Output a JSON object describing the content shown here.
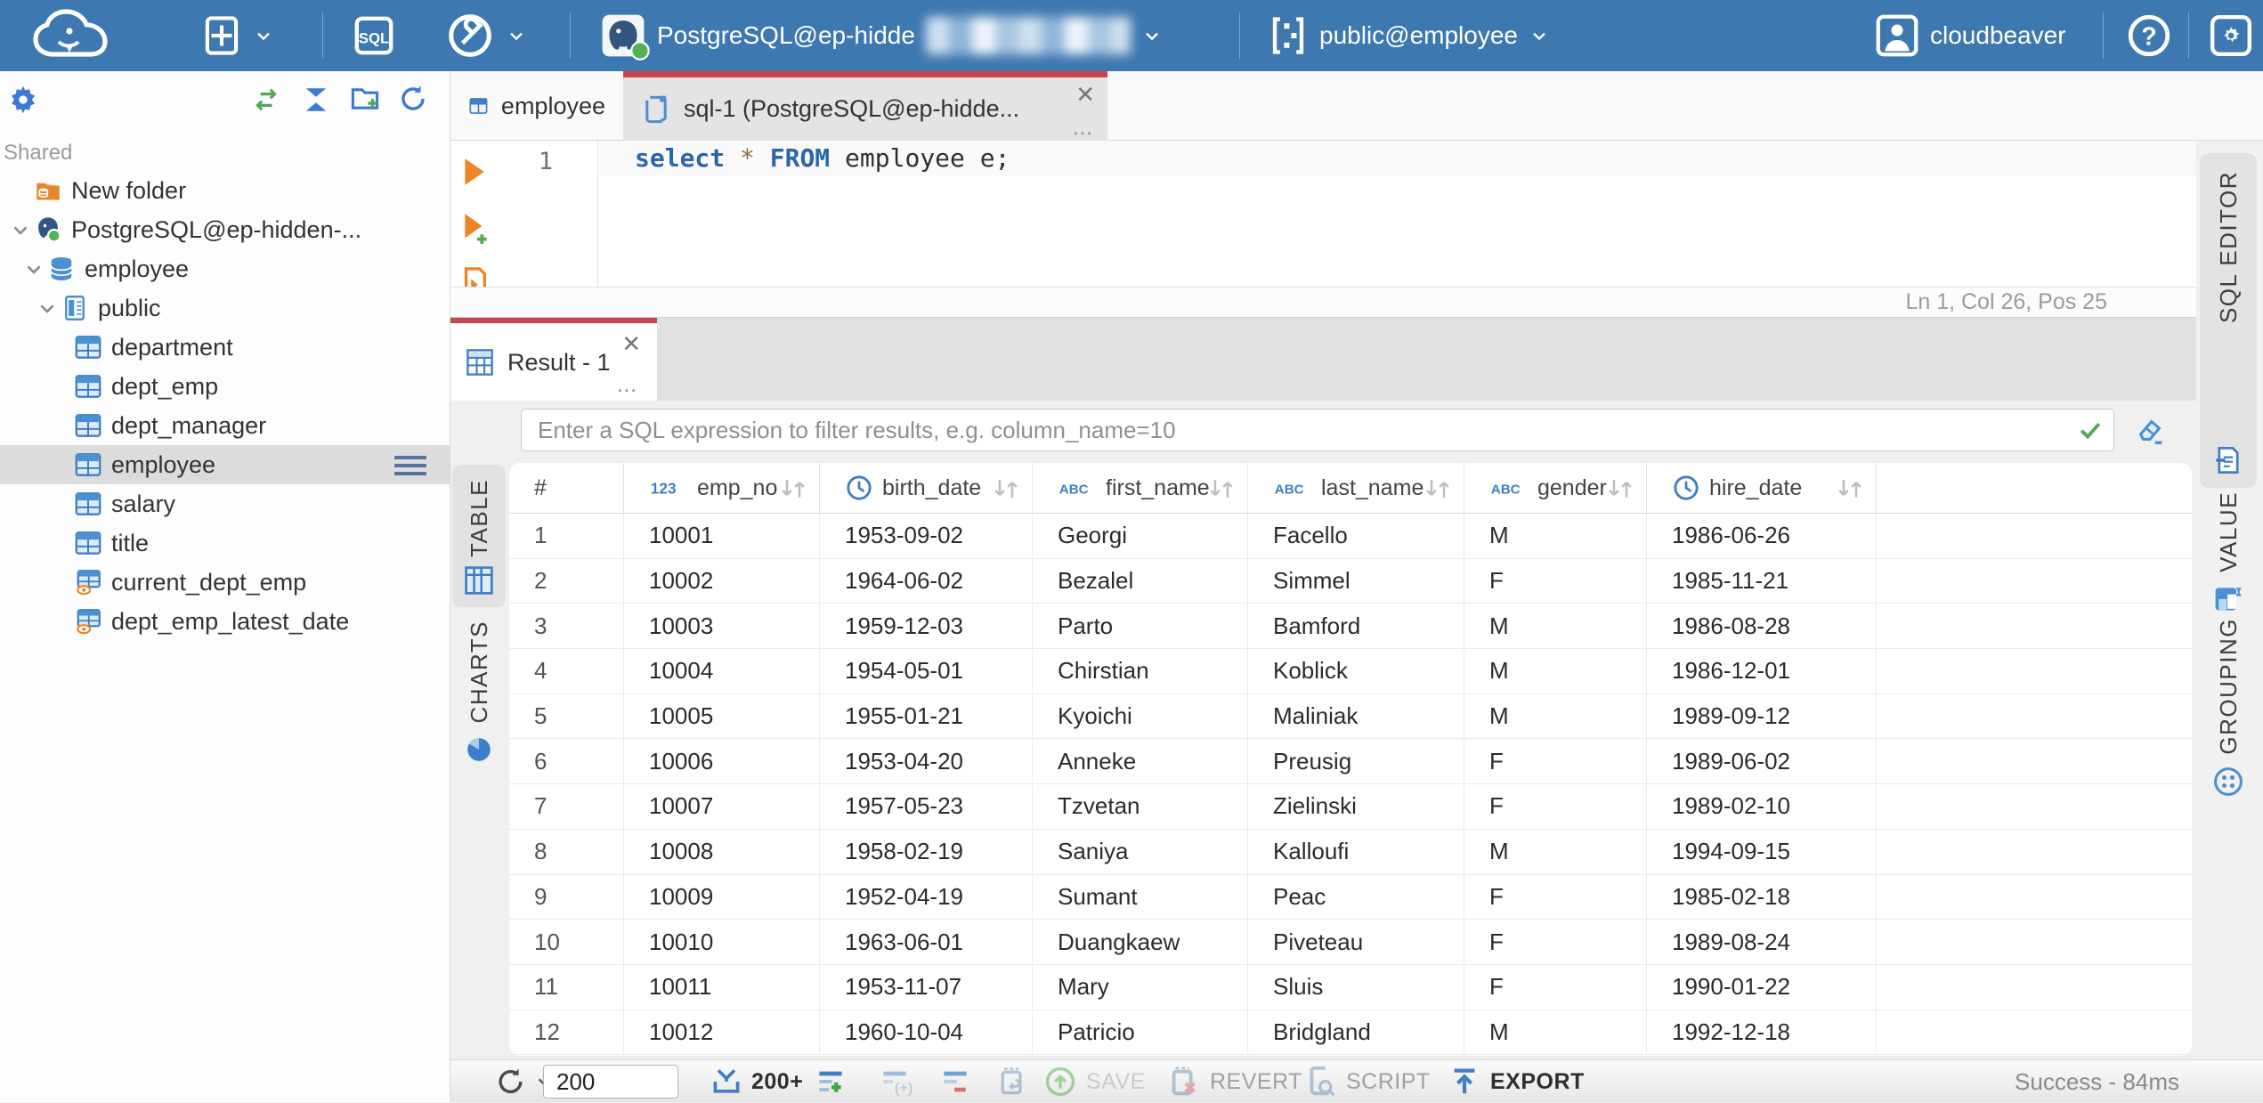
{
  "topbar": {
    "connection": {
      "label": "PostgreSQL@ep-hidde",
      "masked": true
    },
    "schema_selector": "public@employee",
    "user": "cloudbeaver"
  },
  "sidebar": {
    "section_label": "Shared",
    "tree": [
      {
        "label": "New folder",
        "icon": "folder-db",
        "depth": 0,
        "chevron": false
      },
      {
        "label": "PostgreSQL@ep-hidden-...",
        "icon": "postgres",
        "depth": 0,
        "chevron": true
      },
      {
        "label": "employee",
        "icon": "database",
        "depth": 1,
        "chevron": true
      },
      {
        "label": "public",
        "icon": "schema",
        "depth": 2,
        "chevron": true
      },
      {
        "label": "department",
        "icon": "table",
        "depth": 3,
        "chevron": false
      },
      {
        "label": "dept_emp",
        "icon": "table",
        "depth": 3,
        "chevron": false
      },
      {
        "label": "dept_manager",
        "icon": "table",
        "depth": 3,
        "chevron": false
      },
      {
        "label": "employee",
        "icon": "table",
        "depth": 3,
        "chevron": false,
        "selected": true
      },
      {
        "label": "salary",
        "icon": "table",
        "depth": 3,
        "chevron": false
      },
      {
        "label": "title",
        "icon": "table",
        "depth": 3,
        "chevron": false
      },
      {
        "label": "current_dept_emp",
        "icon": "view",
        "depth": 3,
        "chevron": false
      },
      {
        "label": "dept_emp_latest_date",
        "icon": "view",
        "depth": 3,
        "chevron": false
      }
    ]
  },
  "editor": {
    "tabs": [
      {
        "label": "employee",
        "icon": "table",
        "active": false
      },
      {
        "label": "sql-1 (PostgreSQL@ep-hidde...",
        "icon": "sql-script",
        "active": true
      }
    ],
    "line_number": "1",
    "code_tokens": [
      {
        "t": "select",
        "c": "kw"
      },
      {
        "t": " ",
        "c": "pl"
      },
      {
        "t": "*",
        "c": "star"
      },
      {
        "t": " ",
        "c": "pl"
      },
      {
        "t": "FROM",
        "c": "kw"
      },
      {
        "t": " employee e;",
        "c": "pl"
      }
    ],
    "status": "Ln 1, Col 26, Pos 25",
    "rail_tab": "SQL EDITOR"
  },
  "results": {
    "tab_label": "Result - 1",
    "filter_placeholder": "Enter a SQL expression to filter results, e.g. column_name=10",
    "left_rail": [
      {
        "label": "TABLE",
        "active": true
      },
      {
        "label": "CHARTS",
        "active": false
      }
    ],
    "right_rail": [
      {
        "label": "VALUE"
      },
      {
        "label": "GROUPING"
      }
    ],
    "grid": {
      "columns": [
        {
          "name": "#",
          "type": "none"
        },
        {
          "name": "emp_no",
          "type": "number"
        },
        {
          "name": "birth_date",
          "type": "date"
        },
        {
          "name": "first_name",
          "type": "text"
        },
        {
          "name": "last_name",
          "type": "text"
        },
        {
          "name": "gender",
          "type": "text"
        },
        {
          "name": "hire_date",
          "type": "date"
        }
      ],
      "rows": [
        [
          "1",
          "10001",
          "1953-09-02",
          "Georgi",
          "Facello",
          "M",
          "1986-06-26"
        ],
        [
          "2",
          "10002",
          "1964-06-02",
          "Bezalel",
          "Simmel",
          "F",
          "1985-11-21"
        ],
        [
          "3",
          "10003",
          "1959-12-03",
          "Parto",
          "Bamford",
          "M",
          "1986-08-28"
        ],
        [
          "4",
          "10004",
          "1954-05-01",
          "Chirstian",
          "Koblick",
          "M",
          "1986-12-01"
        ],
        [
          "5",
          "10005",
          "1955-01-21",
          "Kyoichi",
          "Maliniak",
          "M",
          "1989-09-12"
        ],
        [
          "6",
          "10006",
          "1953-04-20",
          "Anneke",
          "Preusig",
          "F",
          "1989-06-02"
        ],
        [
          "7",
          "10007",
          "1957-05-23",
          "Tzvetan",
          "Zielinski",
          "F",
          "1989-02-10"
        ],
        [
          "8",
          "10008",
          "1958-02-19",
          "Saniya",
          "Kalloufi",
          "M",
          "1994-09-15"
        ],
        [
          "9",
          "10009",
          "1952-04-19",
          "Sumant",
          "Peac",
          "F",
          "1985-02-18"
        ],
        [
          "10",
          "10010",
          "1963-06-01",
          "Duangkaew",
          "Piveteau",
          "F",
          "1989-08-24"
        ],
        [
          "11",
          "10011",
          "1953-11-07",
          "Mary",
          "Sluis",
          "F",
          "1990-01-22"
        ],
        [
          "12",
          "10012",
          "1960-10-04",
          "Patricio",
          "Bridgland",
          "M",
          "1992-12-18"
        ]
      ]
    },
    "footer": {
      "row_limit": "200",
      "fetch_label": "200+",
      "save_label": "SAVE",
      "revert_label": "REVERT",
      "script_label": "SCRIPT",
      "export_label": "EXPORT",
      "status": "Success - 84ms"
    }
  },
  "colors": {
    "topbar_blue": "#3e78b0",
    "accent_red": "#c8434a",
    "icon_blue": "#3f7fc1",
    "green": "#58a758",
    "orange": "#ef8426"
  }
}
